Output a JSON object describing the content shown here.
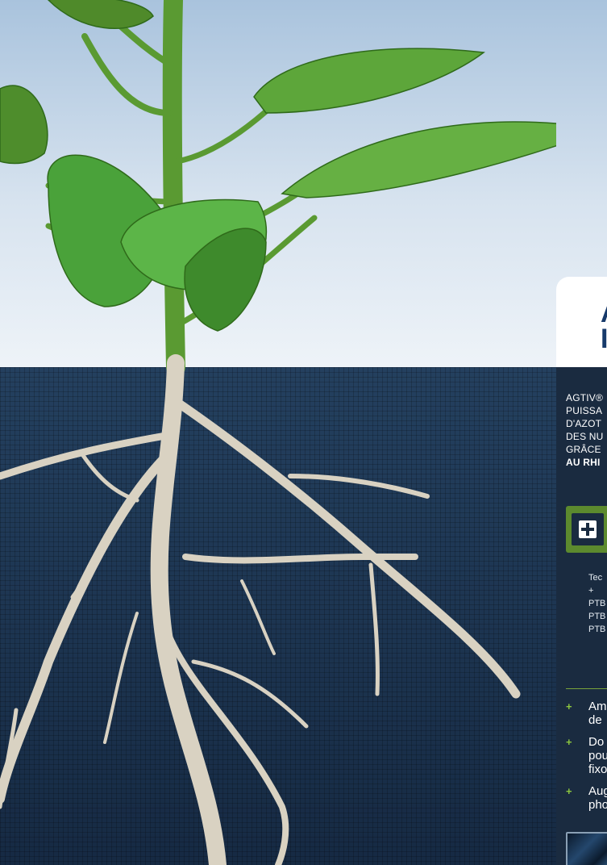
{
  "brand": {
    "line1": "A",
    "line2": "I"
  },
  "claim": {
    "lines": [
      "AGTIV®",
      "PUISSA",
      "D'AZOT",
      "DES NU",
      "GRÂCE",
      "AU RHI"
    ]
  },
  "technology": {
    "lines": [
      "Tec",
      "+",
      "PTB",
      "PTB",
      "PTB"
    ]
  },
  "benefits": [
    {
      "lines": [
        "Am",
        "de"
      ]
    },
    {
      "lines": [
        "Do",
        "pou",
        "fixo"
      ]
    },
    {
      "lines": [
        "Aug",
        "pho"
      ]
    }
  ],
  "colors": {
    "accent_green": "#8cc63f",
    "panel_navy": "#1a2b40",
    "brand_blue": "#173a6b"
  }
}
